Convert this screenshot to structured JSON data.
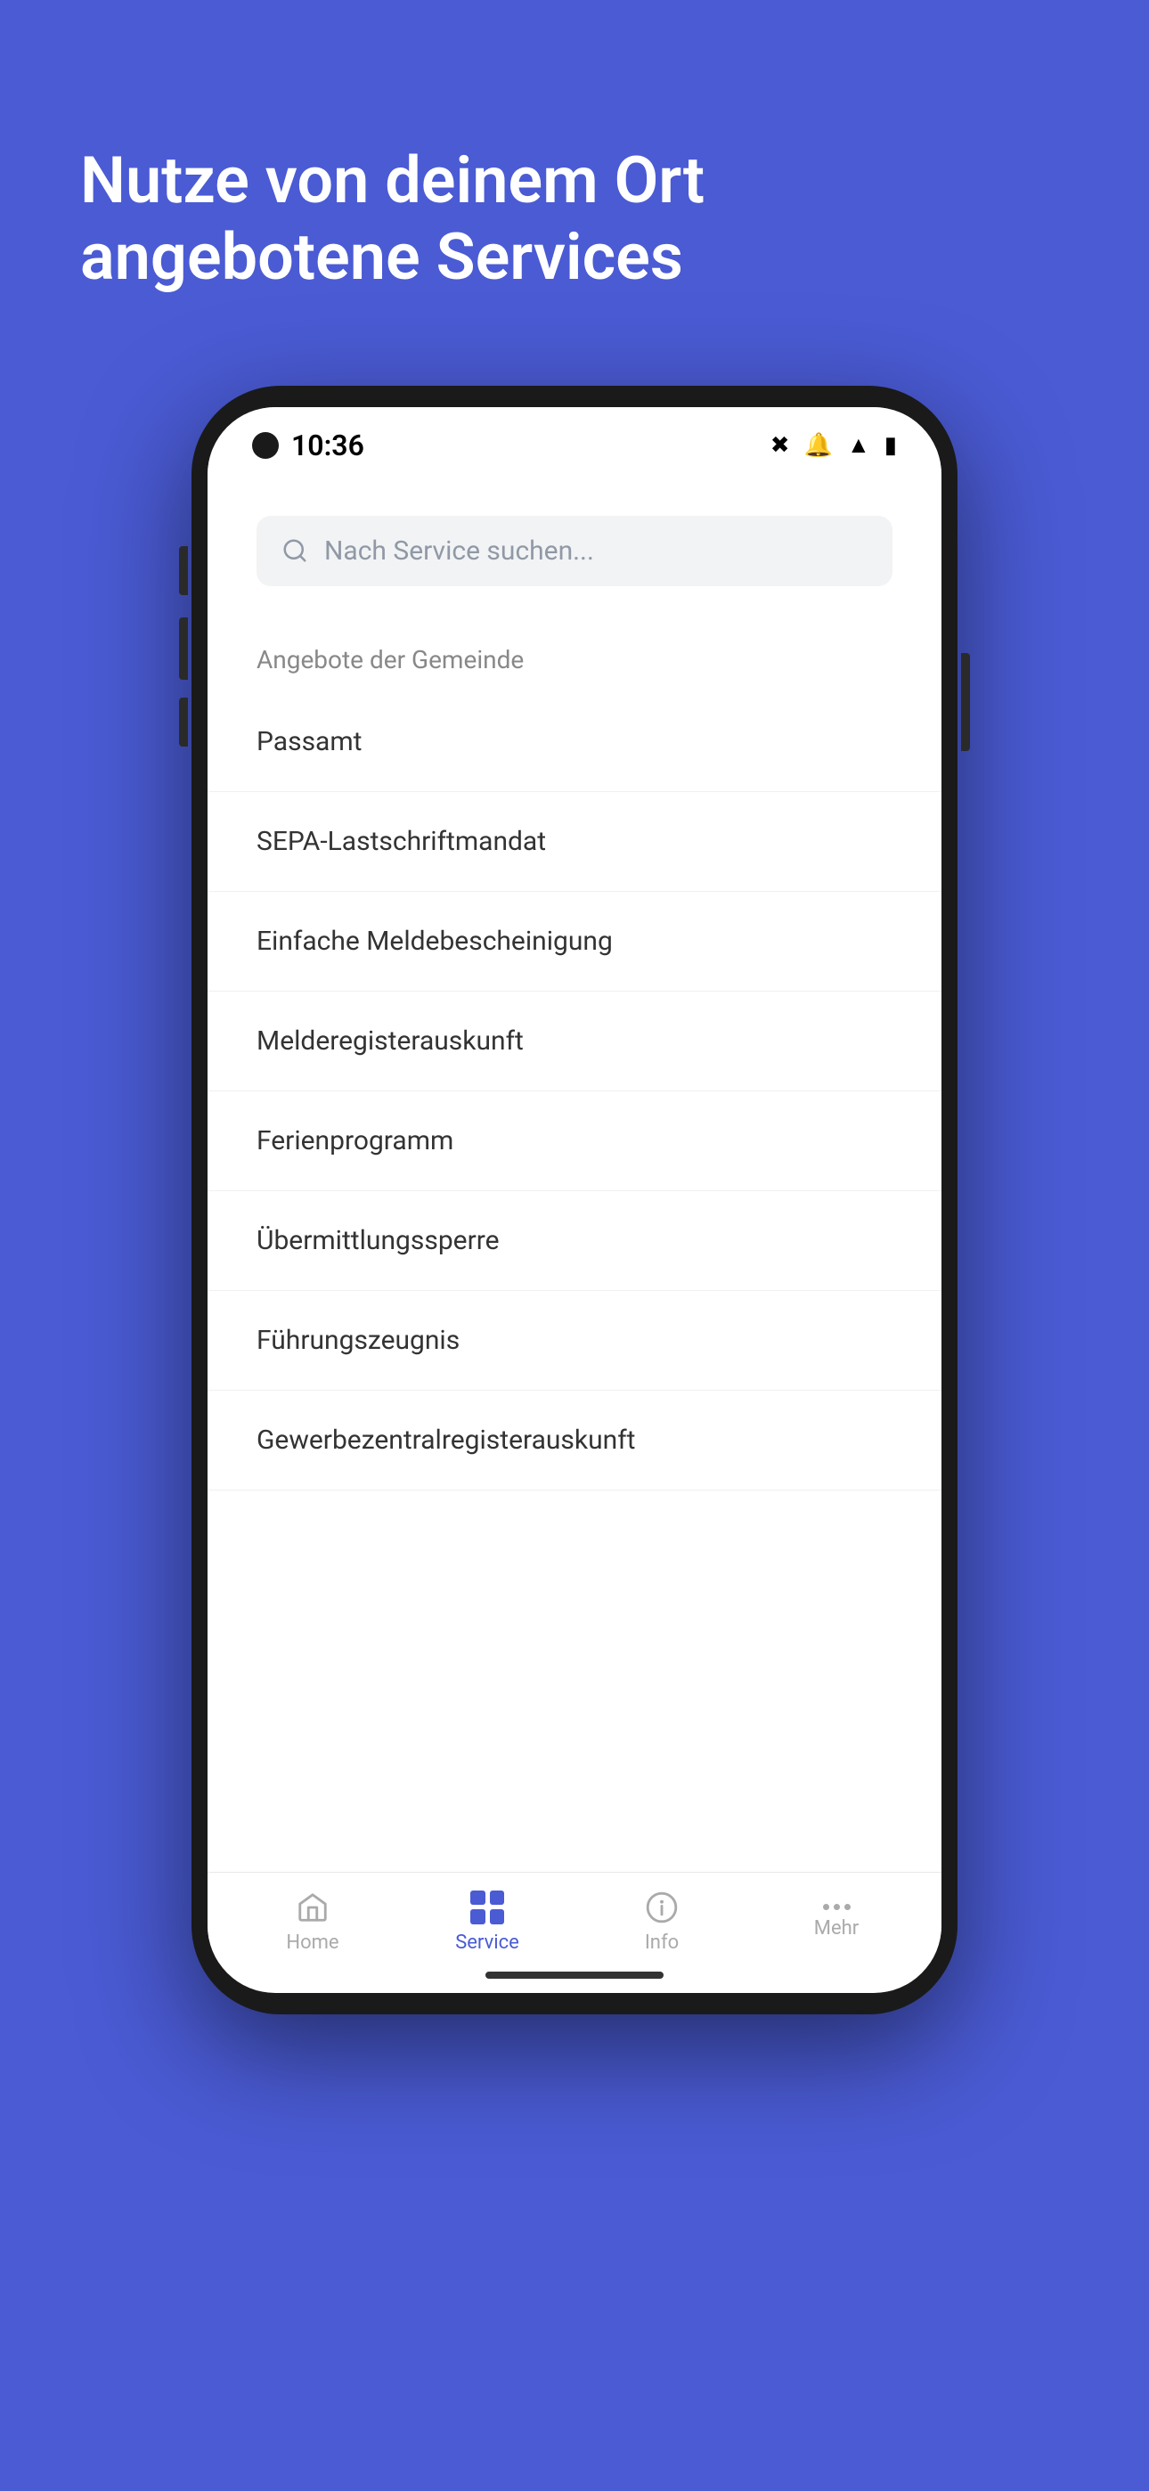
{
  "background_color": "#4A5BD4",
  "headline": {
    "line1": "Nutze von deinem Ort",
    "line2": "angebotene Services"
  },
  "status_bar": {
    "time": "10:36",
    "icons": [
      "bluetooth",
      "muted",
      "wifi",
      "battery"
    ]
  },
  "search": {
    "placeholder": "Nach Service suchen..."
  },
  "section": {
    "label": "Angebote der Gemeinde"
  },
  "services": [
    {
      "name": "Passamt"
    },
    {
      "name": "SEPA-Lastschriftmandat"
    },
    {
      "name": "Einfache Meldebescheinigung"
    },
    {
      "name": "Melderegisterauskunft"
    },
    {
      "name": "Ferienprogramm"
    },
    {
      "name": "Übermittlungssperre"
    },
    {
      "name": "Führungszeugnis"
    },
    {
      "name": "Gewerbezentralregisterauskunft"
    }
  ],
  "bottom_nav": {
    "items": [
      {
        "id": "home",
        "label": "Home",
        "active": false
      },
      {
        "id": "service",
        "label": "Service",
        "active": true
      },
      {
        "id": "info",
        "label": "Info",
        "active": false
      },
      {
        "id": "mehr",
        "label": "Mehr",
        "active": false
      }
    ]
  }
}
